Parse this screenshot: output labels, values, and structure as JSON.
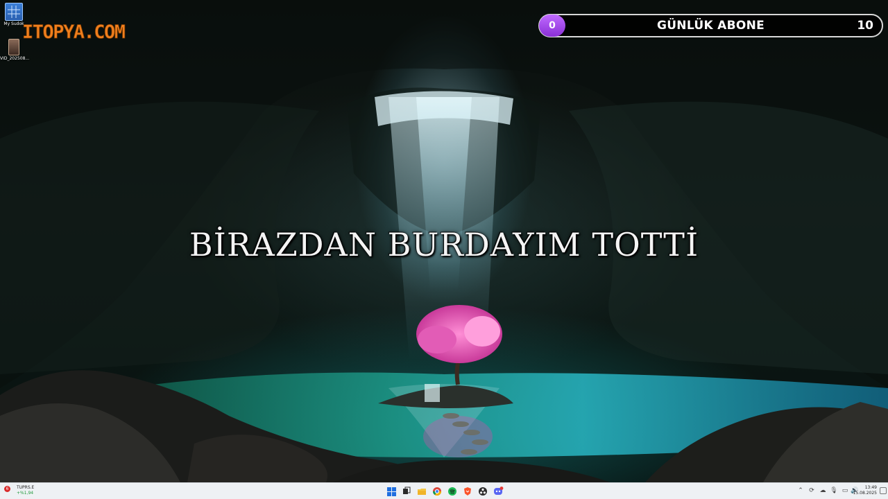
{
  "desktop": {
    "icons": [
      {
        "label": "My Sudok",
        "icon": "sudoku-grid-icon"
      },
      {
        "label": "VID_202508...",
        "icon": "video-file-icon"
      }
    ]
  },
  "logo": {
    "text": "ITOPYA.COM",
    "color": "#f07f1e"
  },
  "subscriber_counter": {
    "current": "0",
    "label": "GÜNLÜK ABONE",
    "goal": "10",
    "badge_color": "#b05cf0"
  },
  "caption": "BİRAZDAN BURDAYIM TOTTİ",
  "taskbar": {
    "stock": {
      "name": "TUPRS.E",
      "change": "+%1,94",
      "badge": "6"
    },
    "apps": [
      {
        "name": "start",
        "icon": "windows-start-icon"
      },
      {
        "name": "task-view",
        "icon": "task-view-icon"
      },
      {
        "name": "file-explorer",
        "icon": "folder-icon"
      },
      {
        "name": "chrome",
        "icon": "chrome-icon"
      },
      {
        "name": "spotify",
        "icon": "spotify-icon"
      },
      {
        "name": "brave",
        "icon": "brave-icon"
      },
      {
        "name": "obs",
        "icon": "obs-icon"
      },
      {
        "name": "discord",
        "icon": "discord-icon"
      }
    ],
    "tray": {
      "time": "13:49",
      "date": "15.08.2025"
    }
  }
}
